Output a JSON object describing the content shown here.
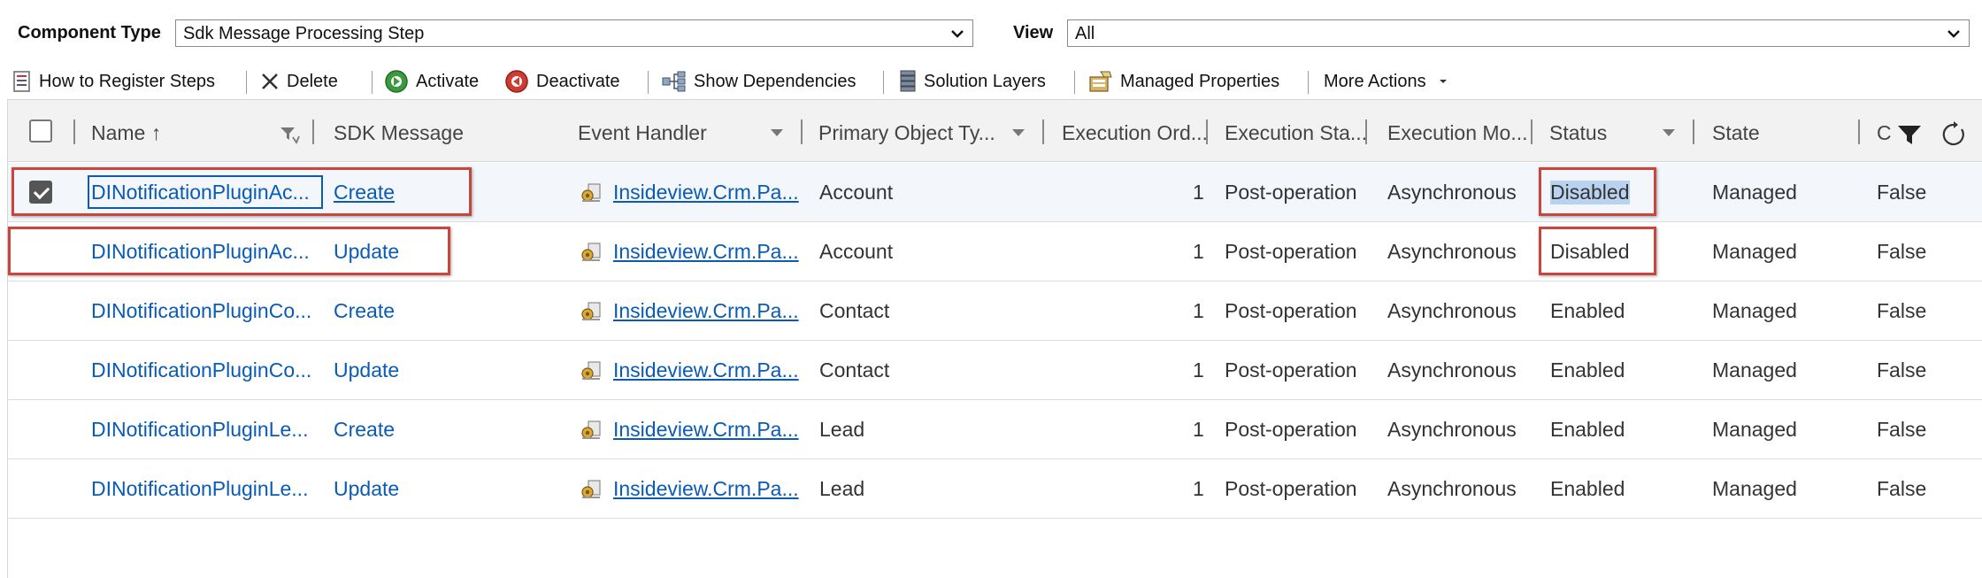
{
  "filters": {
    "component_type_label": "Component Type",
    "component_type_value": "Sdk Message Processing Step",
    "view_label": "View",
    "view_value": "All"
  },
  "toolbar": {
    "how_to_register": "How to Register Steps",
    "delete": "Delete",
    "activate": "Activate",
    "deactivate": "Deactivate",
    "show_dependencies": "Show Dependencies",
    "solution_layers": "Solution Layers",
    "managed_properties": "Managed Properties",
    "more_actions": "More Actions"
  },
  "columns": {
    "name": "Name ↑",
    "sdk_message": "SDK Message",
    "event_handler": "Event Handler",
    "primary_object": "Primary Object Ty...",
    "execution_order": "Execution Ord...",
    "execution_stage": "Execution Sta...",
    "execution_mode": "Execution Mo...",
    "status": "Status",
    "state": "State",
    "customizable": "C"
  },
  "rows": [
    {
      "name": "DINotificationPluginAc...",
      "sdk_message": "Create",
      "event_handler": "Insideview.Crm.Pa...",
      "primary_object": "Account",
      "execution_order": "1",
      "execution_stage": "Post-operation",
      "execution_mode": "Asynchronous",
      "status": "Disabled",
      "state": "Managed",
      "customizable": "False",
      "selected": true
    },
    {
      "name": "DINotificationPluginAc...",
      "sdk_message": "Update",
      "event_handler": "Insideview.Crm.Pa...",
      "primary_object": "Account",
      "execution_order": "1",
      "execution_stage": "Post-operation",
      "execution_mode": "Asynchronous",
      "status": "Disabled",
      "state": "Managed",
      "customizable": "False",
      "selected": false
    },
    {
      "name": "DINotificationPluginCo...",
      "sdk_message": "Create",
      "event_handler": "Insideview.Crm.Pa...",
      "primary_object": "Contact",
      "execution_order": "1",
      "execution_stage": "Post-operation",
      "execution_mode": "Asynchronous",
      "status": "Enabled",
      "state": "Managed",
      "customizable": "False",
      "selected": false
    },
    {
      "name": "DINotificationPluginCo...",
      "sdk_message": "Update",
      "event_handler": "Insideview.Crm.Pa...",
      "primary_object": "Contact",
      "execution_order": "1",
      "execution_stage": "Post-operation",
      "execution_mode": "Asynchronous",
      "status": "Enabled",
      "state": "Managed",
      "customizable": "False",
      "selected": false
    },
    {
      "name": "DINotificationPluginLe...",
      "sdk_message": "Create",
      "event_handler": "Insideview.Crm.Pa...",
      "primary_object": "Lead",
      "execution_order": "1",
      "execution_stage": "Post-operation",
      "execution_mode": "Asynchronous",
      "status": "Enabled",
      "state": "Managed",
      "customizable": "False",
      "selected": false
    },
    {
      "name": "DINotificationPluginLe...",
      "sdk_message": "Update",
      "event_handler": "Insideview.Crm.Pa...",
      "primary_object": "Lead",
      "execution_order": "1",
      "execution_stage": "Post-operation",
      "execution_mode": "Asynchronous",
      "status": "Enabled",
      "state": "Managed",
      "customizable": "False",
      "selected": false
    }
  ],
  "colors": {
    "link": "#0a5bb5",
    "highlight_box": "#c9463c",
    "selection": "#b8d2f0"
  }
}
